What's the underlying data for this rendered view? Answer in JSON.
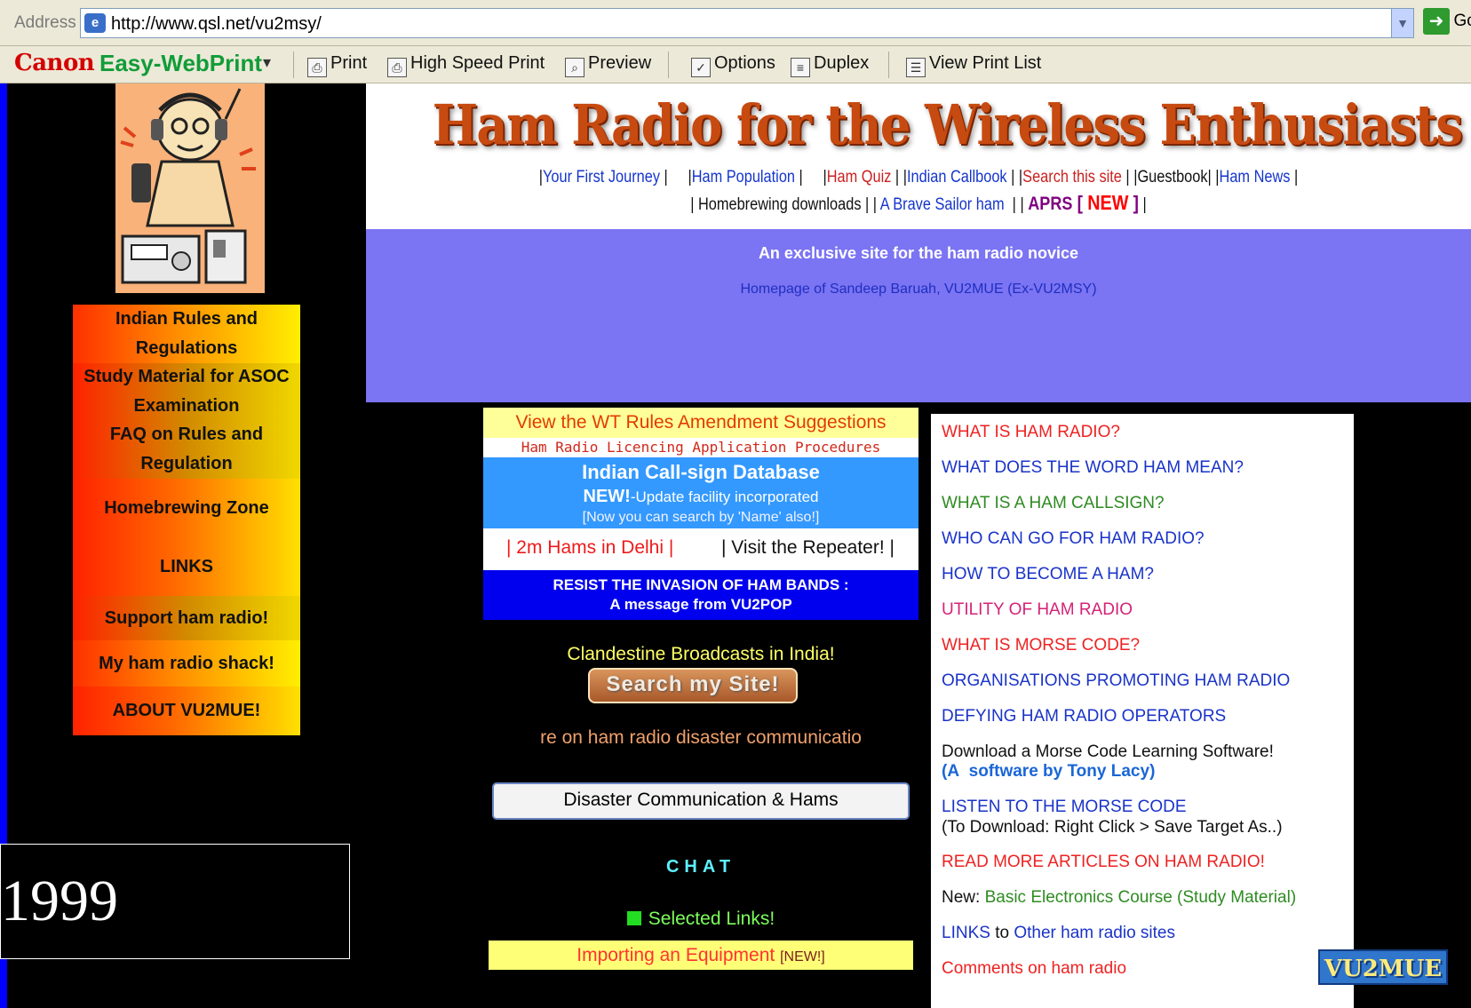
{
  "browser": {
    "address_label": "Address",
    "url": "http://www.qsl.net/vu2msy/",
    "go_label": "Go"
  },
  "toolbar": {
    "brand": "Canon",
    "product": "Easy-WebPrint",
    "buttons": [
      "Print",
      "High Speed Print",
      "Preview",
      "Options",
      "Duplex",
      "View Print List"
    ]
  },
  "banner": {
    "title": "Ham Radio for the Wireless Enthusiasts",
    "nav_row1": {
      "first_journey": "Your First Journey",
      "population": "Ham Population",
      "quiz": "Ham Quiz",
      "callbook": "Indian Callbook",
      "search": "Search this site",
      "guestbook": "Guestbook",
      "news": "Ham News"
    },
    "nav_row2": {
      "homebrew": "Homebrewing downloads",
      "brave_sailor": "A Brave Sailor ham",
      "aprs": "APRS",
      "new_badge": "NEW"
    },
    "tagline": "An exclusive site for the ham radio novice",
    "homepage_of": "Homepage of Sandeep Baruah, VU2MUE (Ex-VU2MSY)"
  },
  "left_menu": [
    "Indian Rules and Regulations",
    "Study Material for ASOC Examination",
    "FAQ on Rules and Regulation",
    "Homebrewing Zone",
    "LINKS",
    "Support ham radio!",
    "My ham radio shack!",
    "ABOUT VU2MUE!"
  ],
  "center": {
    "wt_rules": "View the WT Rules Amendment Suggestions",
    "licencing": "Ham Radio Licencing Application Procedures",
    "callsign_title": "Indian Call-sign Database",
    "callsign_new": "NEW!",
    "callsign_update": "-Update facility incorporated",
    "callsign_search": "[Now you can search by 'Name' also!]",
    "hams_delhi": "| 2m Hams in Delhi |",
    "visit_repeater": "| Visit the Repeater! |",
    "resist_line1": "RESIST THE INVASION OF HAM BANDS :",
    "resist_line2": "A message from VU2POP",
    "clandestine": "Clandestine Broadcasts in India!",
    "search_button": "Search my Site!",
    "marquee": "re on ham radio disaster communicatio",
    "disaster_button": "Disaster Communication & Hams",
    "chat": "CHAT",
    "selected_links": "Selected Links!",
    "importing": "Importing an Equipment",
    "importing_new": "[NEW!]"
  },
  "right": {
    "q1": "WHAT IS HAM RADIO?",
    "q2": "WHAT DOES THE WORD HAM MEAN?",
    "q3": "WHAT IS A HAM CALLSIGN?",
    "q4": "WHO CAN GO FOR HAM RADIO?",
    "q5": "HOW TO BECOME A HAM?",
    "q6": "UTILITY OF HAM RADIO",
    "q7": "WHAT IS MORSE CODE?",
    "q8": "ORGANISATIONS PROMOTING HAM RADIO",
    "q9": "DEFYING HAM RADIO OPERATORS",
    "morse_download": "Download a Morse Code Learning Software!",
    "morse_credit_prefix": "(A",
    "morse_credit": "software by Tony Lacy",
    "morse_credit_suffix": ")",
    "listen": "LISTEN TO THE MORSE CODE",
    "listen_hint": "(To Download: Right Click > Save Target As..)",
    "read_more": "READ MORE ARTICLES ON HAM RADIO!",
    "basic_prefix": "New:",
    "basic_course": "Basic Electronics Course (Study Material)",
    "links_prefix": "LINKS",
    "links_to": "to",
    "links_other": "Other ham radio sites",
    "comments": "Comments on ham radio"
  },
  "logo": "VU2MUE",
  "year": "1999"
}
